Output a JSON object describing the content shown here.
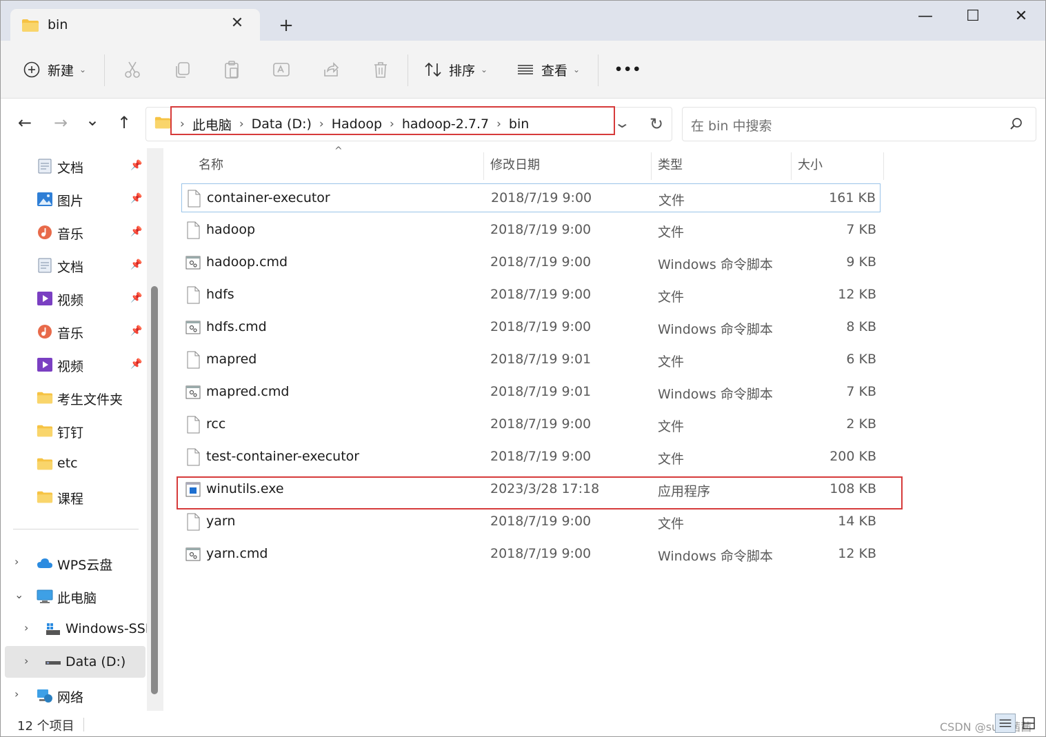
{
  "tab": {
    "title": "bin",
    "close": "✕",
    "new": "+"
  },
  "window_controls": {
    "minimize": "—",
    "maximize": "☐",
    "close": "✕"
  },
  "toolbar": {
    "new_label": "新建",
    "sort_label": "排序",
    "view_label": "查看",
    "more": "•••"
  },
  "nav": {
    "back": "←",
    "forward": "→",
    "recent": "⌄",
    "up": "↑"
  },
  "breadcrumb": [
    "此电脑",
    "Data (D:)",
    "Hadoop",
    "hadoop-2.7.7",
    "bin"
  ],
  "search": {
    "placeholder": "在 bin 中搜索"
  },
  "sidebar": {
    "pinned": [
      {
        "label": "文档",
        "icon": "documents-icon"
      },
      {
        "label": "图片",
        "icon": "pictures-icon"
      },
      {
        "label": "音乐",
        "icon": "music-icon"
      },
      {
        "label": "文档",
        "icon": "documents-icon"
      },
      {
        "label": "视频",
        "icon": "videos-icon"
      },
      {
        "label": "音乐",
        "icon": "music-icon"
      },
      {
        "label": "视频",
        "icon": "videos-icon"
      }
    ],
    "folders": [
      "考生文件夹",
      "钉钉",
      "etc",
      "课程"
    ],
    "tree": [
      {
        "label": "WPS云盘",
        "expand": "›"
      },
      {
        "label": "此电脑",
        "expand": "⌄"
      },
      {
        "label": "Windows-SSD",
        "expand": "›"
      },
      {
        "label": "Data (D:)",
        "expand": "›"
      },
      {
        "label": "网络",
        "expand": "›"
      }
    ]
  },
  "columns": {
    "name": "名称",
    "date": "修改日期",
    "type": "类型",
    "size": "大小"
  },
  "files": [
    {
      "name": "container-executor",
      "date": "2018/7/19 9:00",
      "type": "文件",
      "size": "161 KB",
      "kind": "file"
    },
    {
      "name": "hadoop",
      "date": "2018/7/19 9:00",
      "type": "文件",
      "size": "7 KB",
      "kind": "file"
    },
    {
      "name": "hadoop.cmd",
      "date": "2018/7/19 9:00",
      "type": "Windows 命令脚本",
      "size": "9 KB",
      "kind": "cmd"
    },
    {
      "name": "hdfs",
      "date": "2018/7/19 9:00",
      "type": "文件",
      "size": "12 KB",
      "kind": "file"
    },
    {
      "name": "hdfs.cmd",
      "date": "2018/7/19 9:00",
      "type": "Windows 命令脚本",
      "size": "8 KB",
      "kind": "cmd"
    },
    {
      "name": "mapred",
      "date": "2018/7/19 9:01",
      "type": "文件",
      "size": "6 KB",
      "kind": "file"
    },
    {
      "name": "mapred.cmd",
      "date": "2018/7/19 9:01",
      "type": "Windows 命令脚本",
      "size": "7 KB",
      "kind": "cmd"
    },
    {
      "name": "rcc",
      "date": "2018/7/19 9:00",
      "type": "文件",
      "size": "2 KB",
      "kind": "file"
    },
    {
      "name": "test-container-executor",
      "date": "2018/7/19 9:00",
      "type": "文件",
      "size": "200 KB",
      "kind": "file"
    },
    {
      "name": "winutils.exe",
      "date": "2023/3/28 17:18",
      "type": "应用程序",
      "size": "108 KB",
      "kind": "exe"
    },
    {
      "name": "yarn",
      "date": "2018/7/19 9:00",
      "type": "文件",
      "size": "14 KB",
      "kind": "file"
    },
    {
      "name": "yarn.cmd",
      "date": "2018/7/19 9:00",
      "type": "Windows 命令脚本",
      "size": "12 KB",
      "kind": "cmd"
    }
  ],
  "status": {
    "count": "12 个项目"
  },
  "watermark": "CSDN @sun-茜茜",
  "colors": {
    "highlight_box": "#d63a3a",
    "folder": "#f6c344",
    "selected_nav": "#e5e5e5"
  }
}
